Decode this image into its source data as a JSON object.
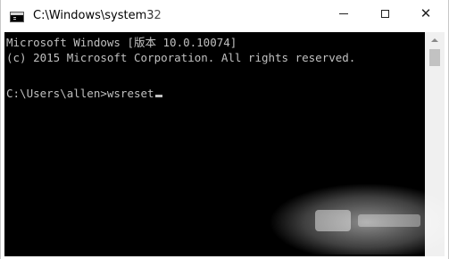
{
  "window": {
    "title": "C:\\Windows\\system32",
    "controls": {
      "minimize_icon": "minimize-icon",
      "maximize_icon": "maximize-icon",
      "close_icon": "close-icon",
      "close_glyph": "✕"
    }
  },
  "console": {
    "lines": [
      "Microsoft Windows [版本 10.0.10074]",
      "(c) 2015 Microsoft Corporation. All rights reserved.",
      "C:\\Users\\allen>wsreset"
    ],
    "background_color": "#000000",
    "text_color": "#c0c0c0"
  }
}
